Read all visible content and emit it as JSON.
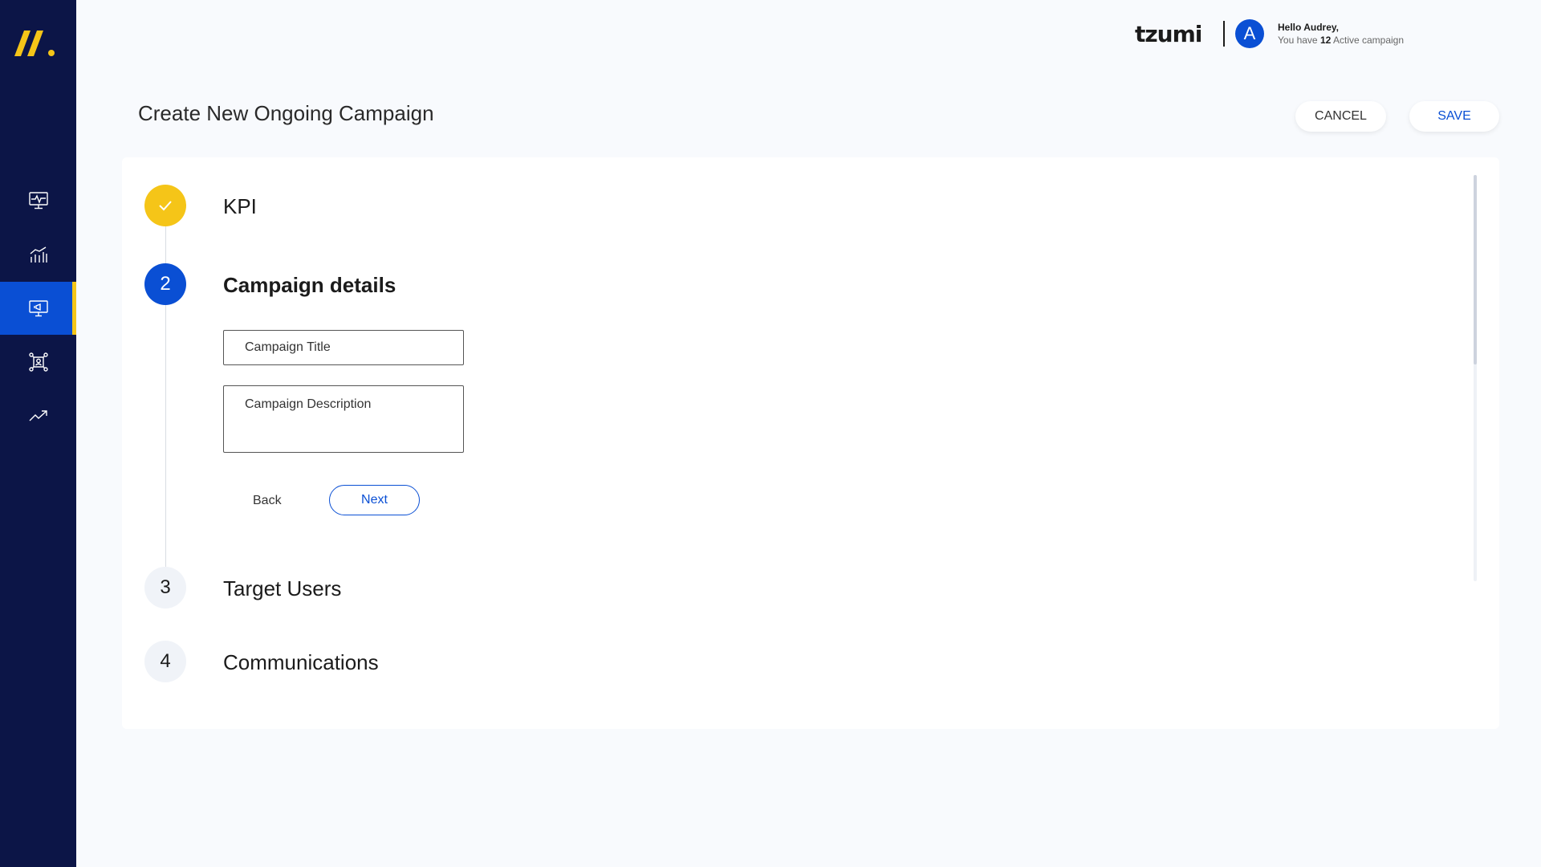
{
  "brand": {
    "logo_icon": "double-slash-logo",
    "accent": "#f5c518"
  },
  "sidebar": {
    "items": [
      {
        "id": "monitor",
        "icon": "monitor-pulse-icon"
      },
      {
        "id": "analytics",
        "icon": "bar-chart-icon"
      },
      {
        "id": "campaigns",
        "icon": "campaign-display-icon",
        "active": true
      },
      {
        "id": "network",
        "icon": "user-network-icon"
      },
      {
        "id": "trends",
        "icon": "trend-up-icon"
      }
    ]
  },
  "header": {
    "client_logo": "tzumi",
    "avatar_initial": "A",
    "greeting": "Hello Audrey,",
    "active_prefix": "You have",
    "active_count": "12",
    "active_suffix": "Active campaign"
  },
  "page": {
    "title": "Create New Ongoing Campaign",
    "cancel_label": "CANCEL",
    "save_label": "SAVE"
  },
  "stepper": {
    "steps": [
      {
        "number": "",
        "label": "KPI",
        "state": "done"
      },
      {
        "number": "2",
        "label": "Campaign details",
        "state": "current"
      },
      {
        "number": "3",
        "label": "Target Users",
        "state": "pending"
      },
      {
        "number": "4",
        "label": "Communications",
        "state": "pending"
      }
    ]
  },
  "form": {
    "title_placeholder": "Campaign Title",
    "description_placeholder": "Campaign Description",
    "back_label": "Back",
    "next_label": "Next"
  },
  "colors": {
    "sidebar_bg": "#0c1547",
    "primary": "#0a4fd4",
    "done": "#f5c518",
    "page_bg": "#f8fafd"
  }
}
